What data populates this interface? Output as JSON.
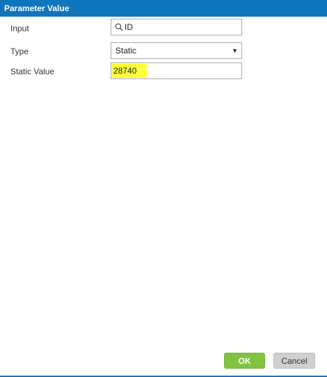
{
  "dialog": {
    "title": "Parameter Value"
  },
  "form": {
    "input": {
      "label": "Input",
      "value": "ID",
      "icon": "search-icon"
    },
    "type": {
      "label": "Type",
      "value": "Static",
      "icon": "dropdown-caret-icon"
    },
    "static_value": {
      "label": "Static Value",
      "value": "28740",
      "highlight_color": "#ffff3a"
    }
  },
  "buttons": {
    "ok_label": "OK",
    "cancel_label": "Cancel"
  },
  "colors": {
    "title_bar": "#0f75bc",
    "ok_button": "#80c342",
    "cancel_button": "#cfcfcf"
  }
}
